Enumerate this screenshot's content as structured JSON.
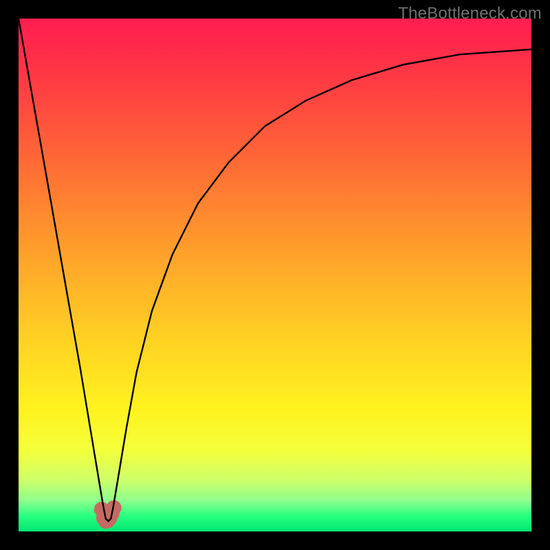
{
  "watermark": "TheBottleneck.com",
  "chart_data": {
    "type": "line",
    "title": "",
    "xlabel": "",
    "ylabel": "",
    "xlim": [
      0,
      100
    ],
    "ylim": [
      0,
      100
    ],
    "grid": false,
    "legend": false,
    "annotations": [],
    "note": "Color gradient: green (bottom, ~0% bottleneck) → yellow → orange → red (top, ~100% bottleneck). Black curve shows bottleneck percentage with a sharp minimum near x≈17.",
    "series": [
      {
        "name": "bottleneck-curve",
        "color": "#000000",
        "x": [
          0,
          3,
          6,
          9,
          12,
          14,
          15.5,
          16.5,
          17,
          17.5,
          18,
          18.5,
          19.5,
          21,
          23,
          26,
          30,
          35,
          41,
          48,
          56,
          65,
          75,
          86,
          100
        ],
        "y": [
          100,
          83,
          66,
          49,
          32,
          20,
          11,
          5,
          2.5,
          2,
          2.5,
          5,
          11,
          20,
          31,
          43,
          54,
          64,
          72,
          79,
          84,
          88,
          91,
          93,
          94
        ]
      },
      {
        "name": "marker-cluster",
        "type": "scatter",
        "color": "#c46a62",
        "x": [
          16.2,
          16.6,
          17.0,
          17.4,
          17.8,
          18.2,
          18.6
        ],
        "y": [
          4.3,
          2.6,
          2.0,
          2.1,
          2.6,
          3.5,
          4.6
        ]
      }
    ]
  }
}
